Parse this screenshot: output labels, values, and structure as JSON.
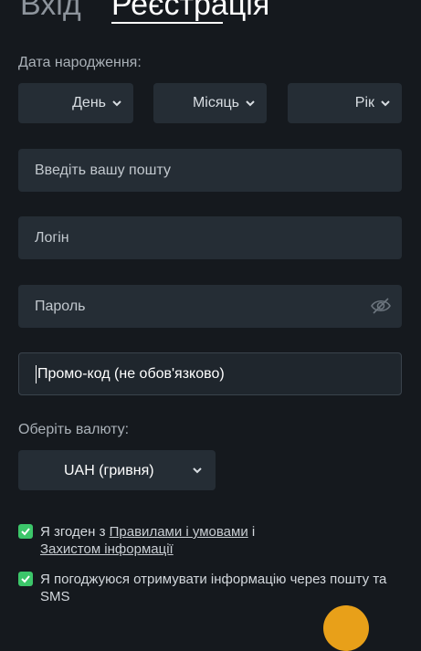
{
  "tabs": {
    "login": "Вхід",
    "register": "Реєстрація",
    "active": "register"
  },
  "dob": {
    "label": "Дата народження:",
    "day": "День",
    "month": "Місяць",
    "year": "Рік"
  },
  "email": {
    "placeholder": "Введіть вашу пошту"
  },
  "login_field": {
    "placeholder": "Логін"
  },
  "password": {
    "placeholder": "Пароль"
  },
  "promo": {
    "value": "Промо-код (не обов'язково)"
  },
  "currency": {
    "label": "Оберіть валюту:",
    "selected": "UAH (гривня)"
  },
  "agreements": {
    "terms_prefix": "Я згоден з ",
    "terms_link": "Правилами і умовами",
    "terms_mid": " і ",
    "privacy_link": "Захистом інформації",
    "terms_checked": true,
    "news_text": "Я погоджуюся отримувати інформацію через пошту та SMS",
    "news_checked": true
  },
  "colors": {
    "background": "#15191e",
    "input": "#252d35",
    "check": "#3cc66a",
    "accent": "#e8a019"
  }
}
